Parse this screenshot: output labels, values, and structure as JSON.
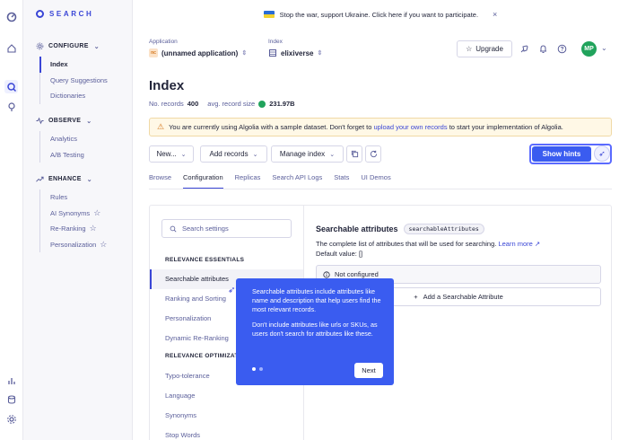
{
  "brand": {
    "name": "SEARCH"
  },
  "banner": {
    "text": "Stop the war, support Ukraine. Click here if you want to participate.",
    "close": "×"
  },
  "sidebar": {
    "configure": {
      "title": "CONFIGURE",
      "items": [
        {
          "label": "Index"
        },
        {
          "label": "Query Suggestions"
        },
        {
          "label": "Dictionaries"
        }
      ]
    },
    "observe": {
      "title": "OBSERVE",
      "items": [
        {
          "label": "Analytics"
        },
        {
          "label": "A/B Testing"
        }
      ]
    },
    "enhance": {
      "title": "ENHANCE",
      "items": [
        {
          "label": "Rules"
        },
        {
          "label": "AI Synonyms"
        },
        {
          "label": "Re-Ranking"
        },
        {
          "label": "Personalization"
        }
      ]
    }
  },
  "header": {
    "application_label": "Application",
    "application_value": "(unnamed application)",
    "application_badge": "nc",
    "index_label": "Index",
    "index_value": "elixiverse",
    "upgrade_label": "Upgrade",
    "avatar_initials": "MP"
  },
  "page": {
    "title": "Index",
    "records_label": "No. records",
    "records_value": "400",
    "size_label": "avg. record size",
    "size_value": "231.97B"
  },
  "alert": {
    "text_before": "You are currently using Algolia with a sample dataset. Don't forget to",
    "link": "upload your own records",
    "text_after": "to start your implementation of Algolia."
  },
  "toolbar": {
    "new_label": "New...",
    "add_records_label": "Add records",
    "manage_index_label": "Manage index",
    "show_hints_label": "Show hints"
  },
  "tabs": [
    "Browse",
    "Configuration",
    "Replicas",
    "Search API Logs",
    "Stats",
    "UI Demos"
  ],
  "settings": {
    "search_placeholder": "Search settings",
    "group1_title": "RELEVANCE ESSENTIALS",
    "group1_items": [
      "Searchable attributes",
      "Ranking and Sorting",
      "Personalization",
      "Dynamic Re-Ranking"
    ],
    "group2_title": "RELEVANCE OPTIMIZATIONS",
    "group2_items": [
      "Typo-tolerance",
      "Language",
      "Synonyms",
      "Stop Words"
    ]
  },
  "detail": {
    "title": "Searchable attributes",
    "code": "searchableAttributes",
    "description": "The complete list of attributes that will be used for searching.",
    "learn_more": "Learn more",
    "default_value": "Default value: []",
    "not_configured": "Not configured",
    "add_label": "Add a Searchable Attribute"
  },
  "tooltip": {
    "p1": "Searchable attributes include attributes like name and description that help users find the most relevant records.",
    "p2": "Don't include attributes like urls or SKUs, as users don't search for attributes like these.",
    "next_label": "Next"
  }
}
